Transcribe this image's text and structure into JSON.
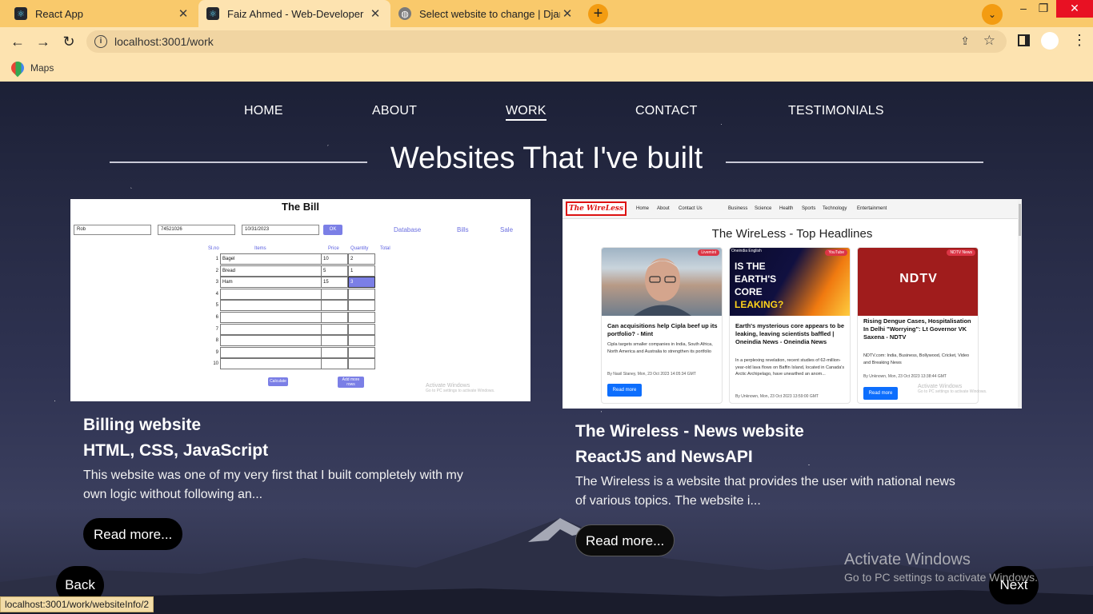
{
  "browser": {
    "tabs": [
      {
        "title": "React App",
        "icon": "react-icon",
        "active": false
      },
      {
        "title": "Faiz Ahmed - Web-Developer",
        "icon": "react-icon",
        "active": true
      },
      {
        "title": "Select website to change | Djang",
        "icon": "globe-icon",
        "active": false
      }
    ],
    "new_tab": "+",
    "url": "localhost:3001/work",
    "bookmark": "Maps",
    "status_url": "localhost:3001/work/websiteInfo/2",
    "accent": "#f9c96b"
  },
  "nav": {
    "items": [
      "HOME",
      "ABOUT",
      "WORK",
      "CONTACT",
      "TESTIMONIALS"
    ],
    "active": "WORK"
  },
  "heading": "Websites That I've built",
  "projects": [
    {
      "title": "Billing website",
      "tech": "HTML, CSS, JavaScript",
      "desc_line1": "This website was one of my very first that I built completely with my",
      "desc_line2": "own logic without following an...",
      "read_more": "Read more..."
    },
    {
      "title": "The Wireless - News website",
      "tech": "ReactJS and NewsAPI",
      "desc_line1": "The Wireless is a website that provides the user with national news",
      "desc_line2": "of various topics. The website i...",
      "read_more": "Read more..."
    }
  ],
  "bill": {
    "title": "The Bill",
    "inputs": [
      "Rob",
      "74521026",
      "10/31/2023"
    ],
    "ok": "OK",
    "links": [
      "Database",
      "Bills",
      "Sale"
    ],
    "headers": [
      "Sl.no",
      "Items",
      "Price",
      "Quantity",
      "Total"
    ],
    "rows": [
      {
        "no": "1",
        "item": "Bagel",
        "price": "10",
        "qty": "2"
      },
      {
        "no": "2",
        "item": "Bread",
        "price": "5",
        "qty": "1"
      },
      {
        "no": "3",
        "item": "Ham",
        "price": "15",
        "qty": "3"
      },
      {
        "no": "4",
        "item": "",
        "price": "",
        "qty": ""
      },
      {
        "no": "5",
        "item": "",
        "price": "",
        "qty": ""
      },
      {
        "no": "6",
        "item": "",
        "price": "",
        "qty": ""
      },
      {
        "no": "7",
        "item": "",
        "price": "",
        "qty": ""
      },
      {
        "no": "8",
        "item": "",
        "price": "",
        "qty": ""
      },
      {
        "no": "9",
        "item": "",
        "price": "",
        "qty": ""
      },
      {
        "no": "10",
        "item": "",
        "price": "",
        "qty": ""
      }
    ],
    "calculate": "Calculate",
    "add_rows_1": "Add more",
    "add_rows_2": "rows",
    "activate_1": "Activate Windows",
    "activate_2": "Go to PC settings to activate Windows."
  },
  "wireless": {
    "logo": "The WireLess",
    "nav": [
      "Home",
      "About",
      "Contact Us",
      "Business",
      "Science",
      "Health",
      "Sports",
      "Technology",
      "Entertainment"
    ],
    "headline": "The WireLess - Top Headlines",
    "cards": [
      {
        "badge": "Livemint",
        "title": "Can acquisitions help Cipla beef up its portfolio? - Mint",
        "desc": "Cipla targets smaller companies in India, South Africa, North America and Australia to strengthen its portfolio",
        "meta": "By Nasil Staney, Mon, 23 Oct 2023 14:05:34 GMT",
        "button": "Read more"
      },
      {
        "badge": "YouTube",
        "img_label_top": "Oneindia English",
        "img_text": [
          "IS THE",
          "EARTH'S",
          "CORE",
          "LEAKING?"
        ],
        "title": "Earth's mysterious core appears to be leaking, leaving scientists baffled | Oneindia News - Oneindia News",
        "desc": "In a perplexing revelation, recent studies of 62-million-year-old lava flows on Baffin Island, located in Canada's Arctic Archipelago, have unearthed an anom...",
        "meta": "By Unknown, Mon, 23 Oct 2023 13:59:00 GMT",
        "button": "Read more"
      },
      {
        "badge": "NDTV News",
        "img_text": "NDTV",
        "title": "Rising Dengue Cases, Hospitalisation In Delhi \"Worrying\": Lt Governor VK Saxena - NDTV",
        "desc": "NDTV.com: India, Business, Bollywood, Cricket, Video and Breaking News",
        "meta": "By Unknown, Mon, 23 Oct 2023 13:38:44 GMT",
        "button": "Read more"
      }
    ],
    "activate_1": "Activate Windows",
    "activate_2": "Go to PC settings to activate Windows."
  },
  "pager": {
    "back": "Back",
    "next": "Next"
  },
  "activate": {
    "line1": "Activate Windows",
    "line2": "Go to PC settings to activate Windows."
  }
}
